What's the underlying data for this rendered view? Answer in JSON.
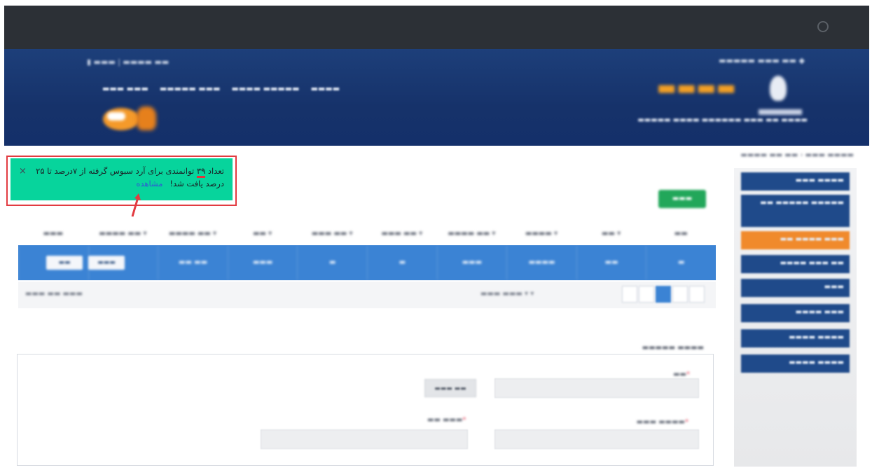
{
  "toast": {
    "prefix": "تعداد ",
    "count": "۳۹",
    "message": " توانمندی برای آرد سبوس گرفته از ۷درصد تا ۲۵ درصد یافت شد!",
    "link_label": "مشاهده",
    "close_glyph": "×",
    "background": "#07d49c"
  },
  "colors": {
    "header_dark": "#2c3036",
    "banner_blue": "#1d3f7a",
    "accent_orange": "#f08a2c",
    "row_selected": "#3b83d4",
    "button_green": "#22a75a",
    "annotation_red": "#e23b41"
  },
  "icons": {
    "power": "power-icon",
    "phone": "phone-icon",
    "login": "login-icon",
    "close": "close-icon",
    "arrow": "arrow-annotation-icon"
  },
  "blurred_note": "Most of the page is blurred; only the green notification toast text is legible."
}
